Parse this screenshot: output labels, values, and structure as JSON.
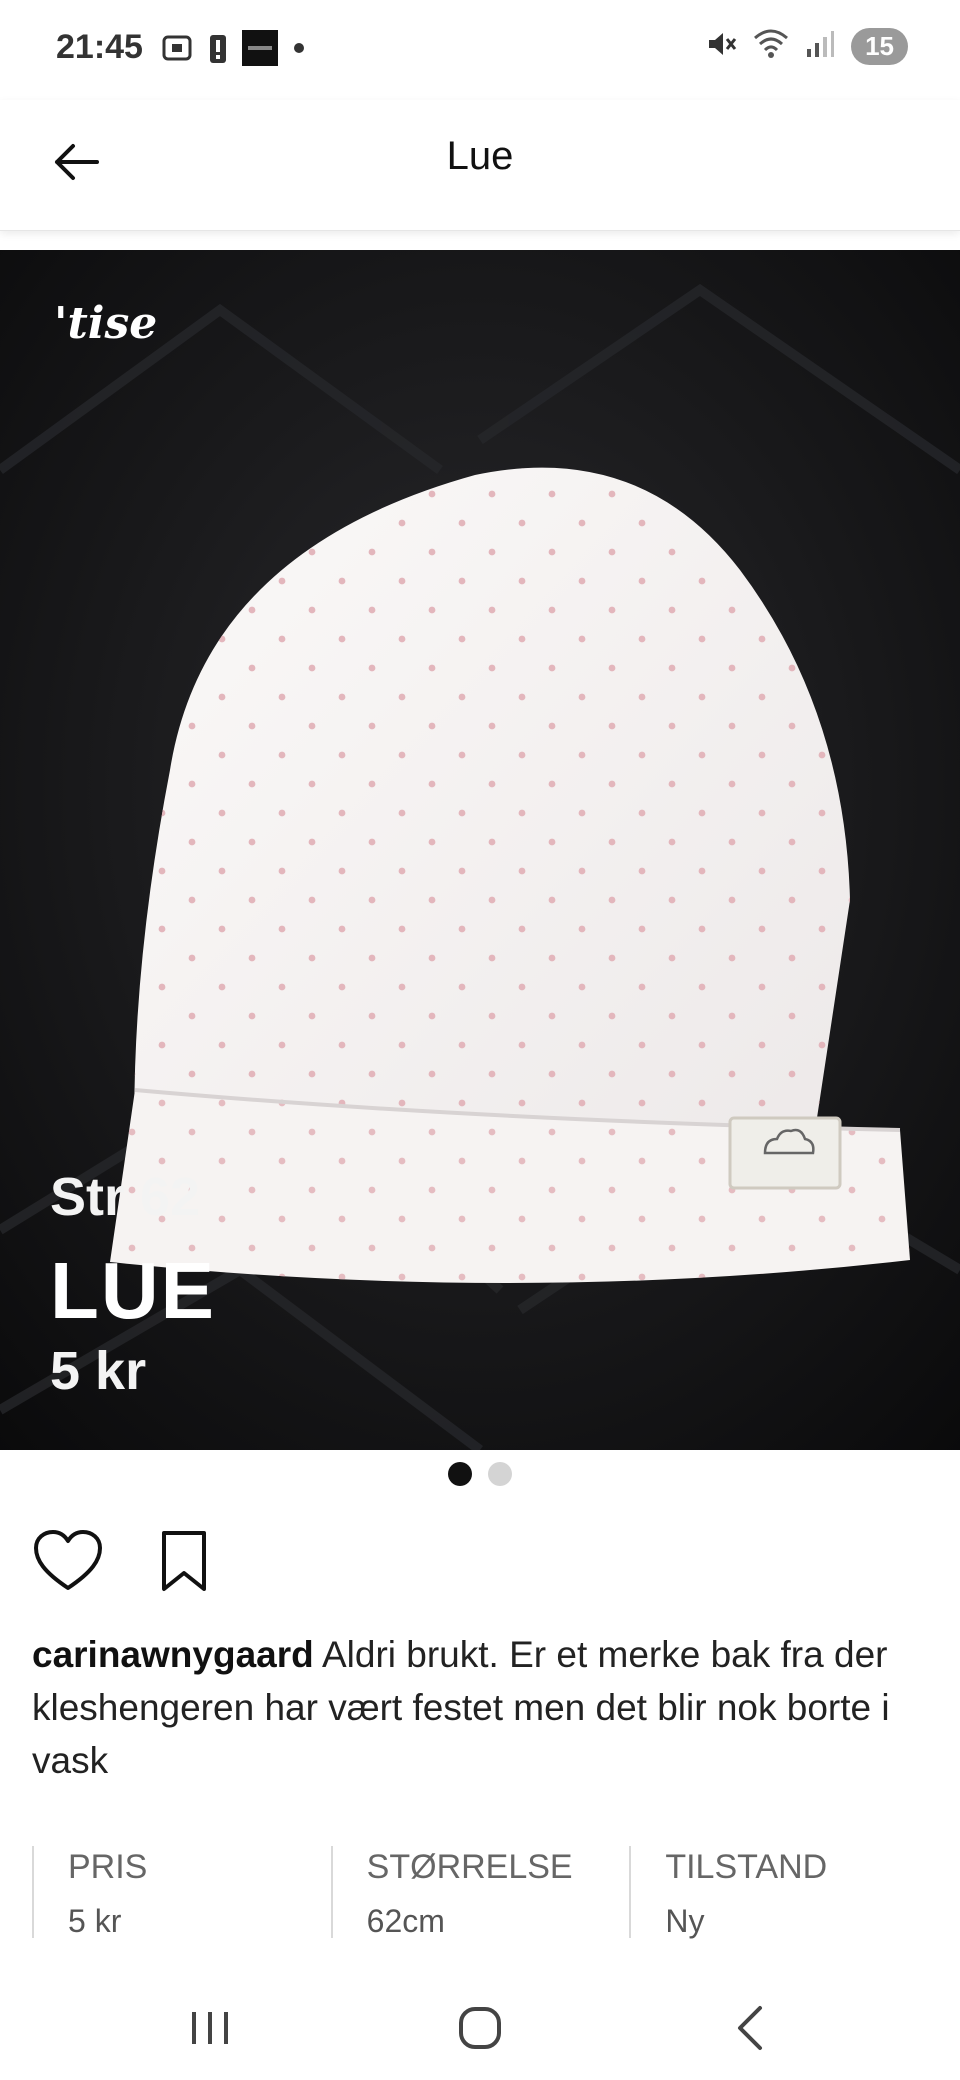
{
  "status_bar": {
    "time": "21:45",
    "left_icons": [
      "screenshot-icon",
      "battery-alert-icon",
      "app-thumbnail-icon",
      "dot-icon"
    ],
    "right_icons": [
      "mute-icon",
      "wifi-icon",
      "signal-icon"
    ],
    "battery_level": "15"
  },
  "app_bar": {
    "title": "Lue"
  },
  "hero": {
    "watermark": "'tise",
    "overlay_size": "Str 62",
    "overlay_title": "LUE",
    "overlay_price": "5 kr"
  },
  "carousel": {
    "total": 2,
    "active_index": 0
  },
  "actions": {
    "like_icon": "heart-outline-icon",
    "save_icon": "bookmark-outline-icon"
  },
  "post": {
    "username": "carinawnygaard",
    "text": "Aldri brukt.  Er et merke bak fra der kleshengeren har vært festet men det blir nok borte i vask"
  },
  "details": {
    "price": {
      "label": "PRIS",
      "value": "5 kr"
    },
    "size": {
      "label": "STØRRELSE",
      "value": "62cm"
    },
    "condition": {
      "label": "TILSTAND",
      "value": "Ny"
    }
  },
  "nav": {
    "recents": "recents-icon",
    "home": "home-icon",
    "back": "back-icon"
  }
}
